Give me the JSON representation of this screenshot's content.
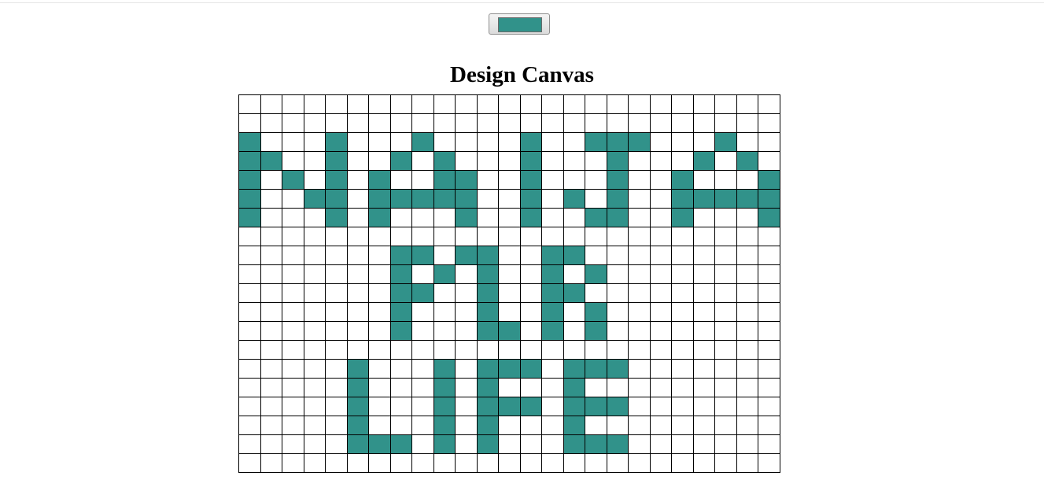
{
  "app": {
    "color_picker_value": "#31928a",
    "title": "Design Canvas",
    "empty_color": "#ffffff"
  },
  "canvas": {
    "rows": 20,
    "cols": 25,
    "pixels": [
      "0000000000000000000000000",
      "0000000000000000000000000",
      "1000100010000100111000100",
      "1100100101000100010001010",
      "1010101001100100010010001",
      "1001101111100101010011111",
      "1000101000100100110010001",
      "0000000000000000000000000",
      "0000000110110011000000000",
      "0000000101010010100000000",
      "0000000110010011000000000",
      "0000000100010010100000000",
      "0000000100011010100000000",
      "0000000000000000000000000",
      "0000010001011101110000000",
      "0000010001010001000000000",
      "0000010001011101110000000",
      "0000010001010001000000000",
      "0000011101010001110000000",
      "0000000000000000000000000"
    ]
  }
}
